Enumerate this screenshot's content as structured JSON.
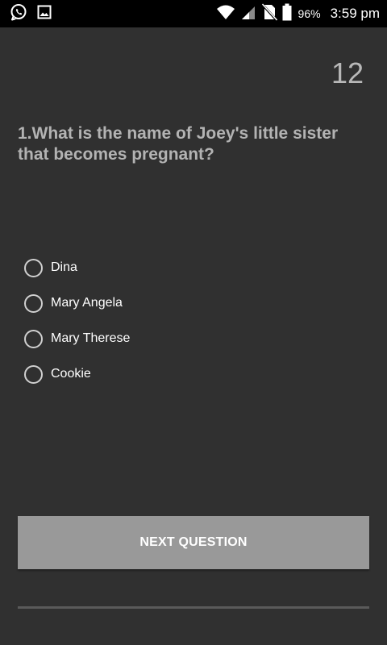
{
  "status_bar": {
    "battery_percent": "96%",
    "time": "3:59 pm",
    "icons": [
      "whatsapp-icon",
      "gallery-icon",
      "wifi-icon",
      "signal-icon",
      "no-sim-icon",
      "battery-icon"
    ]
  },
  "quiz": {
    "score": "12",
    "question": "1.What is the name of Joey's little sister that becomes pregnant?",
    "options": [
      {
        "label": "Dina"
      },
      {
        "label": "Mary Angela"
      },
      {
        "label": "Mary Therese"
      },
      {
        "label": "Cookie"
      }
    ],
    "next_button_label": "NEXT QUESTION"
  },
  "colors": {
    "background": "#303030",
    "status_bar": "#000000",
    "question_text": "#b3b3b3",
    "score_text": "#b8b8b8",
    "button": "#999999",
    "divider": "#5a5a5a"
  }
}
